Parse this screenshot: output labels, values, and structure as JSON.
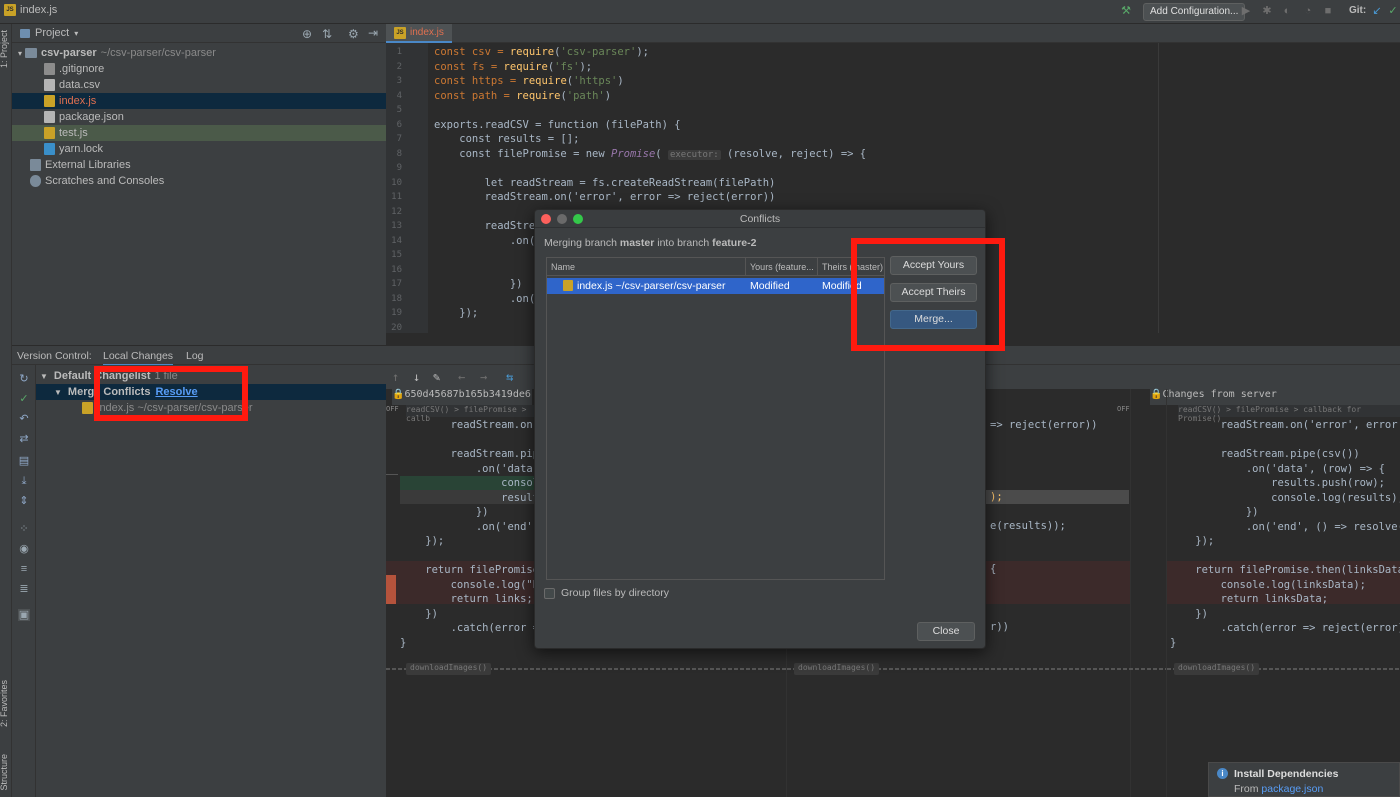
{
  "window": {
    "file_title": "index.js"
  },
  "toolbar": {
    "add_config_label": "Add Configuration...",
    "git_label": "Git:"
  },
  "left_strip": {
    "project_tab": "1: Project",
    "favorites_tab": "2: Favorites",
    "structure_tab": "Structure"
  },
  "project_panel": {
    "title": "Project",
    "root": {
      "name": "csv-parser",
      "path": "~/csv-parser/csv-parser"
    },
    "files": [
      ".gitignore",
      "data.csv",
      "index.js",
      "package.json",
      "test.js",
      "yarn.lock"
    ],
    "extra": [
      "External Libraries",
      "Scratches and Consoles"
    ]
  },
  "editor": {
    "tab_label": "index.js",
    "line_numbers": [
      "1",
      "2",
      "3",
      "4",
      "5",
      "6",
      "7",
      "8",
      "9",
      "10",
      "11",
      "12",
      "13",
      "14",
      "15",
      "16",
      "17",
      "18",
      "19",
      "20"
    ],
    "param_hint": "executor:",
    "code": {
      "l1a": "const csv = ",
      "l1b": "require",
      "l1c": "(",
      "l1d": "'csv-parser'",
      "l1e": ");",
      "l2a": "const fs = ",
      "l2b": "require",
      "l2c": "(",
      "l2d": "'fs'",
      "l2e": ");",
      "l3a": "const https = ",
      "l3b": "require",
      "l3c": "(",
      "l3d": "'https'",
      "l3e": ")",
      "l4a": "const path = ",
      "l4b": "require",
      "l4c": "(",
      "l4d": "'path'",
      "l4e": ")",
      "l6": "exports.readCSV = function (filePath) {",
      "l7": "    const results = [];",
      "l8a": "    const filePromise = new ",
      "l8b": "Promise",
      "l8c": "( ",
      "l8d": " (resolve, reject) => {",
      "l10": "        let readStream = fs.createReadStream(filePath)",
      "l11": "        readStream.on('error', error => reject(error))",
      "l13": "        readStream",
      "l14": "            .on('d",
      "l15": "                co",
      "l16": "                re",
      "l17": "            })",
      "l18": "            .on('e",
      "l19": "    });"
    }
  },
  "version_control": {
    "label": "Version Control:",
    "tabs": [
      "Local Changes",
      "Log"
    ],
    "changelist": "Default Changelist",
    "changelist_count": "1 file",
    "merge_conflicts": "Merge Conflicts",
    "resolve_link": "Resolve",
    "conflict_file": "index.js ~/csv-parser/csv-parser"
  },
  "diff": {
    "left_header": "650d45687b165b3419de6",
    "right_header": "Changes from server",
    "off_label": "OFF",
    "crumb_left": "readCSV() > filePromise > callb",
    "crumb_right": "readCSV() > filePromise > callback for Promise()",
    "fold_label": "downloadImages()",
    "left_lines": [
      "        readStream.on('e",
      "",
      "        readStream.pipe(",
      "            .on('data',",
      "                console.",
      "                results.",
      "            })",
      "            .on('end', (",
      "    });",
      "",
      "    return filePromise.t",
      "        console.log(\"BIG",
      "        return links;",
      "    })",
      "        .catch(error =>",
      "}"
    ],
    "middle_lines": {
      "m1": "=> reject(error))",
      "m2": ");",
      "m3": "e(results));",
      "m4": "{",
      "m5": "r))"
    },
    "right_lines": [
      "        readStream.on('error', error => re",
      "",
      "        readStream.pipe(csv())",
      "            .on('data', (row) => {",
      "                results.push(row);",
      "                console.log(results);",
      "            })",
      "            .on('end', () => resolve(resul",
      "    });",
      "",
      "    return filePromise.then(linksData => {",
      "        console.log(linksData);",
      "        return linksData;",
      "    })",
      "        .catch(error => reject(error))",
      "}"
    ]
  },
  "dialog": {
    "title": "Conflicts",
    "msg_prefix": "Merging branch ",
    "msg_branch1": "master",
    "msg_mid": " into branch ",
    "msg_branch2": "feature-2",
    "columns": [
      "Name",
      "Yours (feature...",
      "Theirs (master)"
    ],
    "row": {
      "name": "index.js ~/csv-parser/csv-parser",
      "yours": "Modified",
      "theirs": "Modified"
    },
    "buttons": {
      "accept_yours": "Accept Yours",
      "accept_theirs": "Accept Theirs",
      "merge": "Merge...",
      "close": "Close"
    },
    "group_by_dir": "Group files by directory"
  },
  "notification": {
    "title": "Install Dependencies",
    "from_prefix": "From ",
    "from_link": "package.json"
  },
  "colors": {
    "accent": "#4a88c7",
    "selection": "#2f65ca",
    "highlight": "#ff1a0f"
  }
}
